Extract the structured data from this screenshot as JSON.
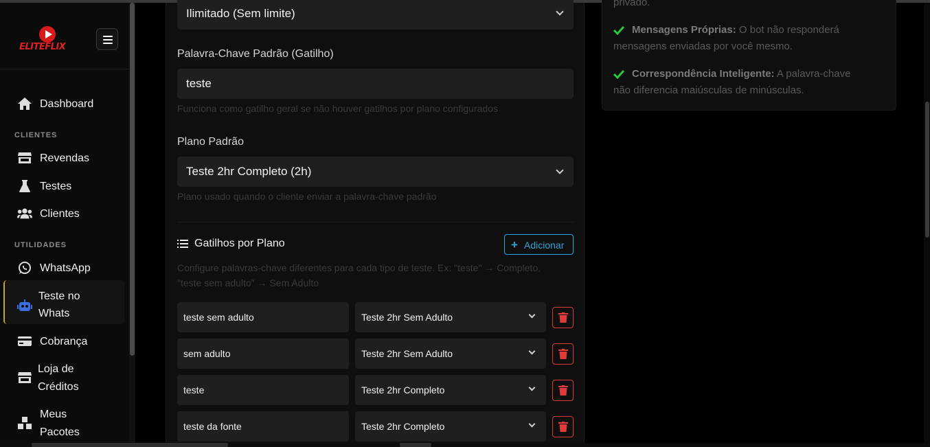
{
  "brand": {
    "logo_text": "ELITEFLIX",
    "logo_color": "#d91a1a"
  },
  "sidebar": {
    "items": [
      {
        "label": "Dashboard",
        "icon": "home-icon"
      },
      {
        "section": "CLIENTES"
      },
      {
        "label": "Revendas",
        "icon": "store-icon"
      },
      {
        "label": "Testes",
        "icon": "flask-icon"
      },
      {
        "label": "Clientes",
        "icon": "users-icon"
      },
      {
        "section": "UTILIDADES"
      },
      {
        "label": "WhatsApp",
        "icon": "whatsapp-icon"
      },
      {
        "label1": "Teste no",
        "label2": "Whats",
        "icon": "robot-icon",
        "active": true
      },
      {
        "label": "Cobrança",
        "icon": "credit-card-icon"
      },
      {
        "label1": "Loja de",
        "label2": "Créditos",
        "icon": "store-icon"
      },
      {
        "label1": "Meus",
        "label2": "Pacotes",
        "icon": "boxes-icon"
      }
    ]
  },
  "form": {
    "limit_select": "Ilimitado (Sem limite)",
    "keyword_label": "Palavra-Chave Padrão (Gatilho)",
    "keyword_value": "teste",
    "keyword_help": "Funciona como gatilho geral se não houver gatilhos por plano configurados",
    "plan_label": "Plano Padrão",
    "plan_value": "Teste 2hr Completo (2h)",
    "plan_help": "Plano usado quando o cliente enviar a palavra-chave padrão",
    "triggers_title": "Gatilhos por Plano",
    "add_label": "Adicionar",
    "triggers_help_1": "Configure palavras-chave diferentes para cada tipo de teste. Ex: \"teste\" → Completo,",
    "triggers_help_2": "\"teste sem adulto\" → Sem Adulto",
    "triggers": [
      {
        "keyword": "teste sem adulto",
        "plan": "Teste 2hr Sem Adulto"
      },
      {
        "keyword": "sem adulto",
        "plan": "Teste 2hr Sem Adulto"
      },
      {
        "keyword": "teste",
        "plan": "Teste 2hr Completo"
      },
      {
        "keyword": "teste da fonte",
        "plan": "Teste 2hr Completo"
      }
    ]
  },
  "info": {
    "top_fragment": "privado.",
    "rows": [
      {
        "title": "Mensagens Próprias:",
        "text": " O bot não responderá",
        "text2": "mensagens enviadas por você mesmo."
      },
      {
        "title": "Correspondência Inteligente:",
        "text": " A palavra-chave",
        "text2": "não diferencia maiúsculas de minúsculas."
      }
    ]
  },
  "colors": {
    "accent": "#2fa4d8",
    "danger": "#d83a3a",
    "success": "#27c93f",
    "active_border": "#c9a227"
  }
}
